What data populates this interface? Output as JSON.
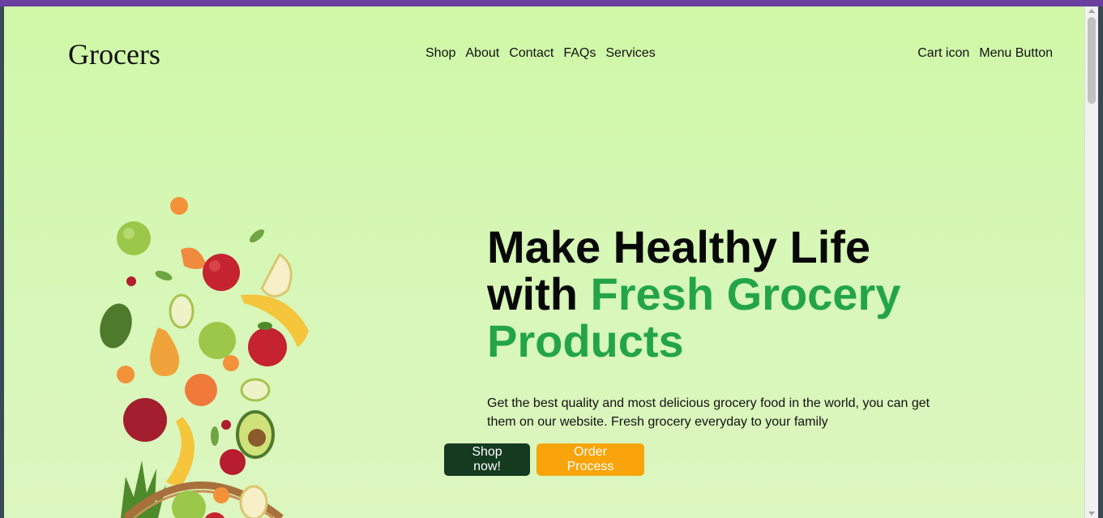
{
  "brand": {
    "name": "Grocers"
  },
  "nav": {
    "items": [
      "Shop",
      "About",
      "Contact",
      "FAQs",
      "Services"
    ]
  },
  "header_right": {
    "cart": "Cart icon",
    "menu": "Menu Button"
  },
  "hero": {
    "title_line1": "Make Healthy Life",
    "title_with": "with ",
    "title_green1": "Fresh Grocery",
    "title_green2": "Products",
    "description": "Get the best quality and most delicious grocery food in the world, you can get them on our website. Fresh grocery everyday to your family",
    "primary_button": "Shop now!",
    "secondary_button": "Order Process",
    "image_icon": "fruit-basket-icon"
  },
  "colors": {
    "accent_green": "#23a547",
    "button_dark": "#143a1f",
    "button_orange": "#f9a40a",
    "background": "#cff8a7",
    "top_stripe": "#6a3fa0"
  }
}
